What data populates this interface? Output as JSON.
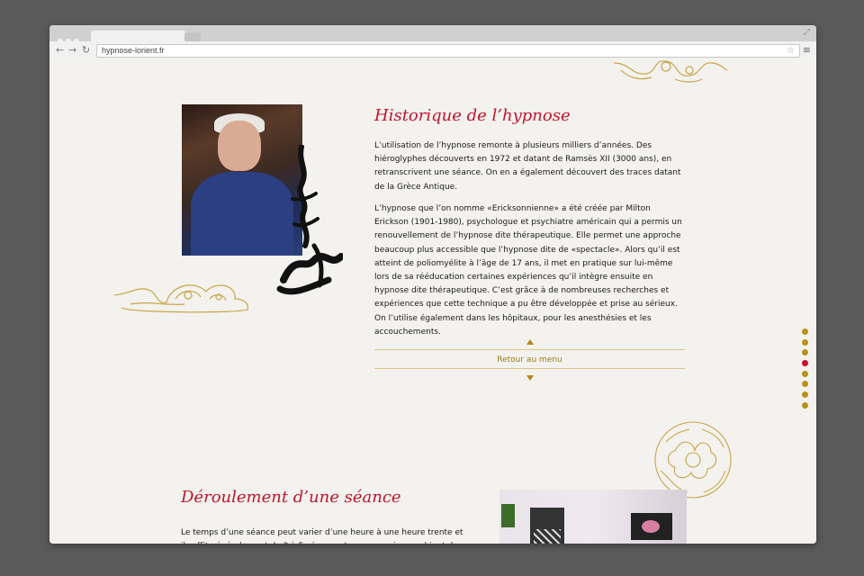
{
  "browser": {
    "url": "hypnose-lorient.fr"
  },
  "section1": {
    "title": "Historique de l’hypnose",
    "paragraph1": "L’utilisation de l’hypnose remonte à plusieurs milliers d’années. Des hiéroglyphes découverts en 1972 et datant de Ramsès XII (3000 ans), en retranscrivent une séance. On en a également découvert des traces datant de la Grèce Antique.",
    "paragraph2": "L’hypnose que l’on nomme «Ericksonnienne» a été créée par Milton Erickson (1901-1980), psychologue et psychiatre américain qui a permis un renouvellement de l’hypnose dite thérapeutique. Elle permet une approche beaucoup plus accessible que l’hypnose dite de «spectacle». Alors qu’il est atteint de poliomyélite à l’âge de 17 ans, il met en pratique sur lui-même lors de sa rééducation certaines expériences qu’il intègre ensuite en hypnose dite thérapeutique. C’est grâce à de nombreuses recherches et expériences que cette technique a pu être développée et prise au sérieux. On l’utilise également dans les hôpitaux, pour les anesthésies et les accouchements.",
    "back_link": "Retour au menu"
  },
  "section2": {
    "title": "Déroulement d’une séance",
    "paragraph": "Le temps d’une séance peut varier d’une heure à une heure trente et il suffit généralement de 3 à 5 séances. Je vous reçois au cabinet du Docteur Philippe à Hennebont."
  },
  "side_nav": {
    "count": 8,
    "active_index": 3
  },
  "colors": {
    "accent_red": "#c0152c",
    "gold": "#b8911c"
  }
}
